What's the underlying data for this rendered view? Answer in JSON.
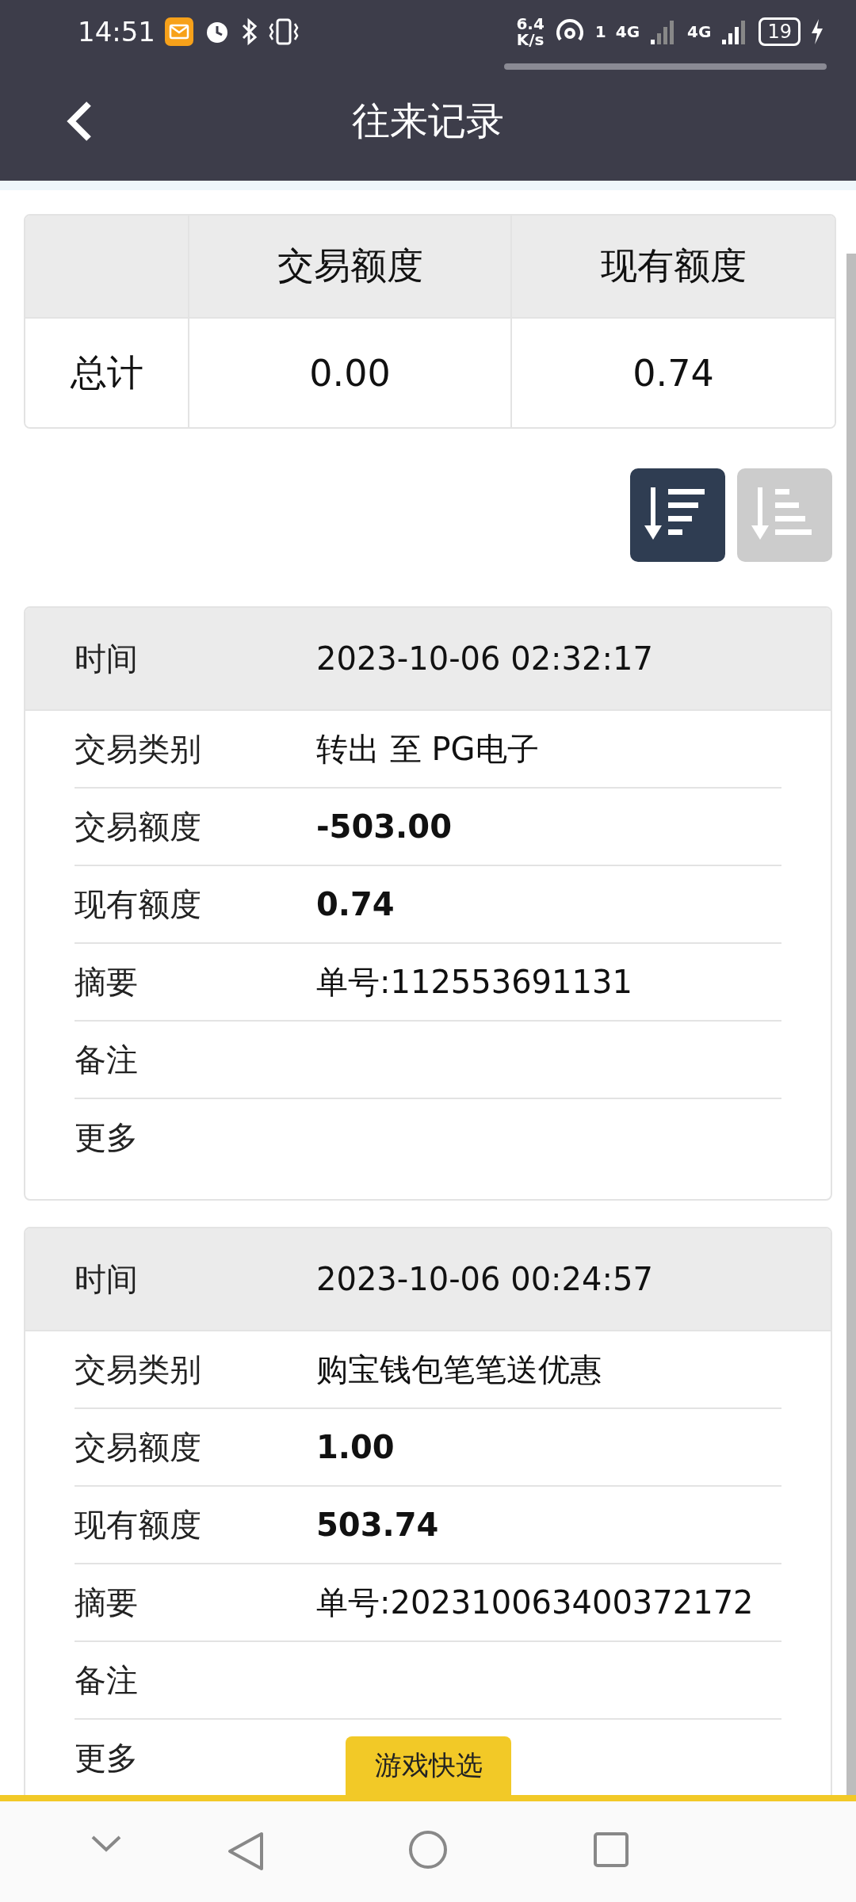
{
  "status_bar": {
    "time": "14:51",
    "speed_value": "6.4",
    "speed_unit": "K/s",
    "hotspot_count": "1",
    "network_1": "4G",
    "network_2": "4G",
    "battery": "19"
  },
  "header": {
    "title": "往来记录"
  },
  "summary": {
    "columns": [
      "交易额度",
      "现有额度"
    ],
    "row_label": "总计",
    "values": [
      "0.00",
      "0.74"
    ]
  },
  "sort_buttons": [
    {
      "kind": "descending",
      "selected": true
    },
    {
      "kind": "ascending",
      "selected": false
    }
  ],
  "records": [
    {
      "time_label": "时间",
      "time": "2023-10-06 02:32:17",
      "rows": [
        {
          "label": "交易类别",
          "value": "转出 至 PG电子",
          "bold": false
        },
        {
          "label": "交易额度",
          "value": "-503.00",
          "bold": true
        },
        {
          "label": "现有额度",
          "value": "0.74",
          "bold": true
        },
        {
          "label": "摘要",
          "value": "单号:112553691131",
          "bold": false
        },
        {
          "label": "备注"
        },
        {
          "label": "更多"
        }
      ]
    },
    {
      "time_label": "时间",
      "time": "2023-10-06 00:24:57",
      "rows": [
        {
          "label": "交易类别",
          "value": "购宝钱包笔笔送优惠",
          "bold": false
        },
        {
          "label": "交易额度",
          "value": "1.00",
          "bold": true
        },
        {
          "label": "现有额度",
          "value": "503.74",
          "bold": true
        },
        {
          "label": "摘要",
          "value": "单号:202310063400372172",
          "bold": false
        },
        {
          "label": "备注"
        },
        {
          "label": "更多"
        }
      ]
    }
  ],
  "quick_tab": {
    "label": "游戏快选"
  }
}
